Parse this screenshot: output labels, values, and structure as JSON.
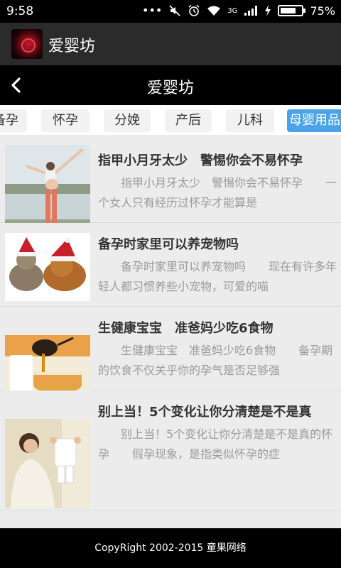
{
  "status": {
    "time": "9:58",
    "network": "3G",
    "battery_pct": "75%",
    "battery_level": 0.75,
    "icons": [
      "more-icon",
      "mute-icon",
      "alarm-icon",
      "wifi-icon",
      "signal-icon",
      "charging-icon"
    ]
  },
  "app": {
    "title": "爱婴坊"
  },
  "nav": {
    "title": "爱婴坊",
    "back_icon": "chevron-left-icon"
  },
  "tabs": [
    {
      "label": "备孕"
    },
    {
      "label": "怀孕"
    },
    {
      "label": "分娩"
    },
    {
      "label": "产后"
    },
    {
      "label": "儿科"
    },
    {
      "label": "母婴用品",
      "active": true
    }
  ],
  "articles": [
    {
      "title": "指甲小月牙太少　警惕你会不易怀孕",
      "desc": "　　指甲小月牙太少　警惕你会不易怀孕　　一个女人只有经历过怀孕才能算是",
      "thumb": "pregnant-woman-beach-photo"
    },
    {
      "title": "备孕时家里可以养宠物吗",
      "desc": "　　备孕时家里可以养宠物吗　　现在有许多年轻人都习惯养些小宠物，可爱的喵",
      "thumb": "cat-and-dog-santa-hats-photo"
    },
    {
      "title": "生健康宝宝　准爸妈少吃6食物",
      "desc": "　　生健康宝宝　准爸妈少吃6食物　　备孕期的饮食不仅关乎你的孕气是否足够强",
      "thumb": "honey-and-milk-photo"
    },
    {
      "title": "别上当！5个变化让你分清楚是不是真",
      "desc": "　　别上当！5个变化让你分清楚是不是真的怀孕　　假孕现象，是指类似怀孕的症",
      "thumb": "mother-with-baby-clothes-photo"
    }
  ],
  "footer": {
    "text": "CopyRight 2002-2015 童果网络"
  }
}
